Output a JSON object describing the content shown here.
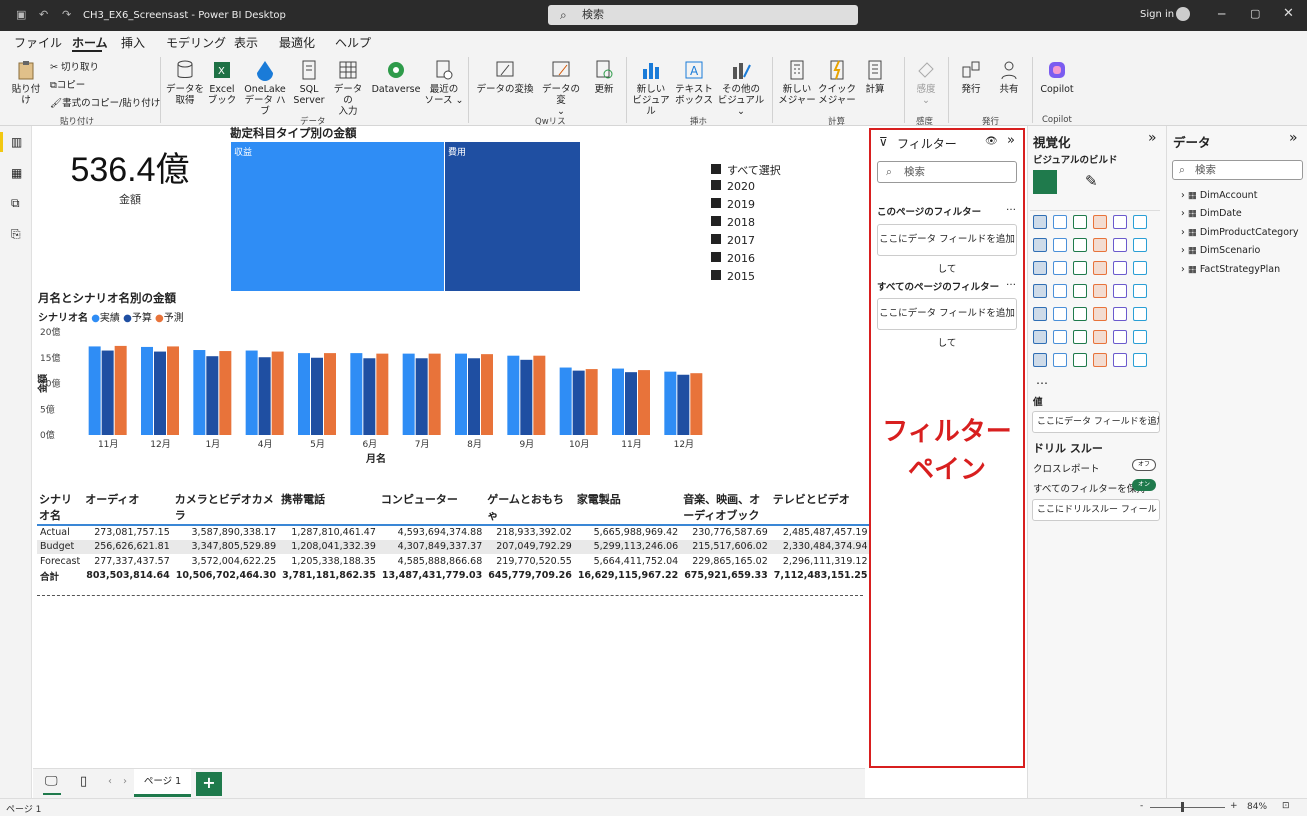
{
  "window": {
    "title": "CH3_EX6_Screensast - Power BI Desktop",
    "search": "検索",
    "sign_in": "Sign in"
  },
  "menu": [
    "ファイル",
    "ホーム",
    "挿入",
    "モデリング",
    "表示",
    "最適化",
    "ヘルプ"
  ],
  "ribbon": {
    "paste": "貼り付け",
    "cut": "切り取り",
    "copy": "コピー",
    "format_copy": "書式のコピー/貼り付け",
    "clipboard_group": "貼り付け",
    "get_data": [
      "データを",
      "取得"
    ],
    "excel": [
      "Excel",
      "ブック"
    ],
    "onelake": [
      "OneLake",
      "データ ハブ"
    ],
    "sql": [
      "SQL",
      "Server"
    ],
    "enter_data": [
      "データの",
      "入力"
    ],
    "dataverse": "Dataverse",
    "recent": [
      "最近の",
      "ソース ⌄"
    ],
    "data_group": "データ",
    "transform": "データの変換",
    "refresh_change": [
      "データの変",
      "⌄"
    ],
    "refresh": "更新",
    "query_group": "Qwリス",
    "new_visual": [
      "新しい",
      "ビジュアル"
    ],
    "textbox": [
      "テキスト",
      "ボックス"
    ],
    "more_visuals": [
      "その他の",
      "ビジュアル ⌄"
    ],
    "insert_group": "挿ホ",
    "new_measure": [
      "新しい",
      "メジャー"
    ],
    "quick_measure": [
      "クイック",
      "メジャー"
    ],
    "calculation": "計算",
    "calc_group": "計算",
    "sensitivity": [
      "感度",
      "⌄"
    ],
    "sensitivity_group": "感度",
    "publish": "発行",
    "share": "共有",
    "publish_group": "発行",
    "copilot": "Copilot",
    "copilot_group": "Copilot"
  },
  "card": {
    "value": "536.4億",
    "label": "金額"
  },
  "treemap": {
    "title": "勘定科目タイプ別の金額",
    "tiles": [
      {
        "label": "収益",
        "value": 0.61,
        "color": "#2f8df5"
      },
      {
        "label": "費用",
        "value": 0.39,
        "color": "#1f4fa2"
      }
    ],
    "legend": [
      "すべて選択",
      "2020",
      "2019",
      "2018",
      "2017",
      "2016",
      "2015"
    ]
  },
  "chart_data": {
    "type": "bar",
    "title": "月名とシナリオ名別の金額",
    "legend_title": "シナリオ名",
    "xlabel": "月名",
    "ylabel": "金額",
    "ylim": [
      0,
      20
    ],
    "yticks": [
      "0億",
      "5億",
      "10億",
      "15億",
      "20億"
    ],
    "categories": [
      "11月",
      "12月",
      "1月",
      "4月",
      "5月",
      "6月",
      "7月",
      "8月",
      "9月",
      "10月",
      "11月",
      "12月"
    ],
    "series": [
      {
        "name": "実績",
        "color": "#2f8df5",
        "values": [
          17.2,
          17.1,
          16.5,
          16.4,
          15.9,
          15.9,
          15.8,
          15.8,
          15.4,
          13.1,
          12.9,
          12.3
        ]
      },
      {
        "name": "予算",
        "color": "#1f4fa2",
        "values": [
          16.4,
          16.2,
          15.3,
          15.1,
          15.0,
          14.9,
          14.9,
          14.9,
          14.6,
          12.5,
          12.2,
          11.7
        ]
      },
      {
        "name": "予測",
        "color": "#e8733a",
        "values": [
          17.3,
          17.2,
          16.3,
          16.2,
          15.9,
          15.8,
          15.8,
          15.7,
          15.4,
          12.8,
          12.6,
          12.0
        ]
      }
    ]
  },
  "matrix": {
    "headers": [
      "シナリオ名",
      "オーディオ",
      "カメラとビデオカメラ",
      "携帯電話",
      "コンピューター",
      "ゲームとおもちゃ",
      "家電製品",
      "音楽、映画、オーディオブック",
      "テレビとビデオ"
    ],
    "rows": [
      [
        "Actual",
        "273,081,757.15",
        "3,587,890,338.17",
        "1,287,810,461.47",
        "4,593,694,374.88",
        "218,933,392.02",
        "5,665,988,969.42",
        "230,776,587.69",
        "2,485,487,457.19"
      ],
      [
        "Budget",
        "256,626,621.81",
        "3,347,805,529.89",
        "1,208,041,332.39",
        "4,307,849,337.37",
        "207,049,792.29",
        "5,299,113,246.06",
        "215,517,606.02",
        "2,330,484,374.94"
      ],
      [
        "Forecast",
        "277,337,437.57",
        "3,572,004,622.25",
        "1,205,338,188.35",
        "4,585,888,866.68",
        "219,770,520.55",
        "5,664,411,752.04",
        "229,865,165.02",
        "2,296,111,319.12"
      ]
    ],
    "total": [
      "合計",
      "803,503,814.64",
      "10,506,702,464.30",
      "3,781,181,862.35",
      "13,487,431,779.03",
      "645,779,709.26",
      "16,629,115,967.22",
      "675,921,659.33",
      "7,112,483,151.25"
    ]
  },
  "filters": {
    "title": "フィルター",
    "search": "検索",
    "page_filters": "このページのフィルター",
    "all_filters": "すべてのページのフィルター",
    "add_field": "ここにデータ フィールドを追加して",
    "annotation": [
      "フィルター",
      "ペイン"
    ]
  },
  "visualizations": {
    "title": "視覚化",
    "build": "ビジュアルのビルド",
    "values": "値",
    "add_field": "ここにデータ フィールドを追加し...",
    "drillthrough": "ドリル スルー",
    "cross_report": "クロスレポート",
    "cross_report_state": "オフ",
    "keep_filters": "すべてのフィルターを保持",
    "keep_filters_state": "オン",
    "add_drill": "ここにドリルスルー フィールドを..."
  },
  "data": {
    "title": "データ",
    "search": "検索",
    "tables": [
      "DimAccount",
      "DimDate",
      "DimProductCategory",
      "DimScenario",
      "FactStrategyPlan"
    ]
  },
  "pages": {
    "tab": "ページ 1",
    "add": "+"
  },
  "status": {
    "page": "ページ 1",
    "zoom": "84%"
  }
}
